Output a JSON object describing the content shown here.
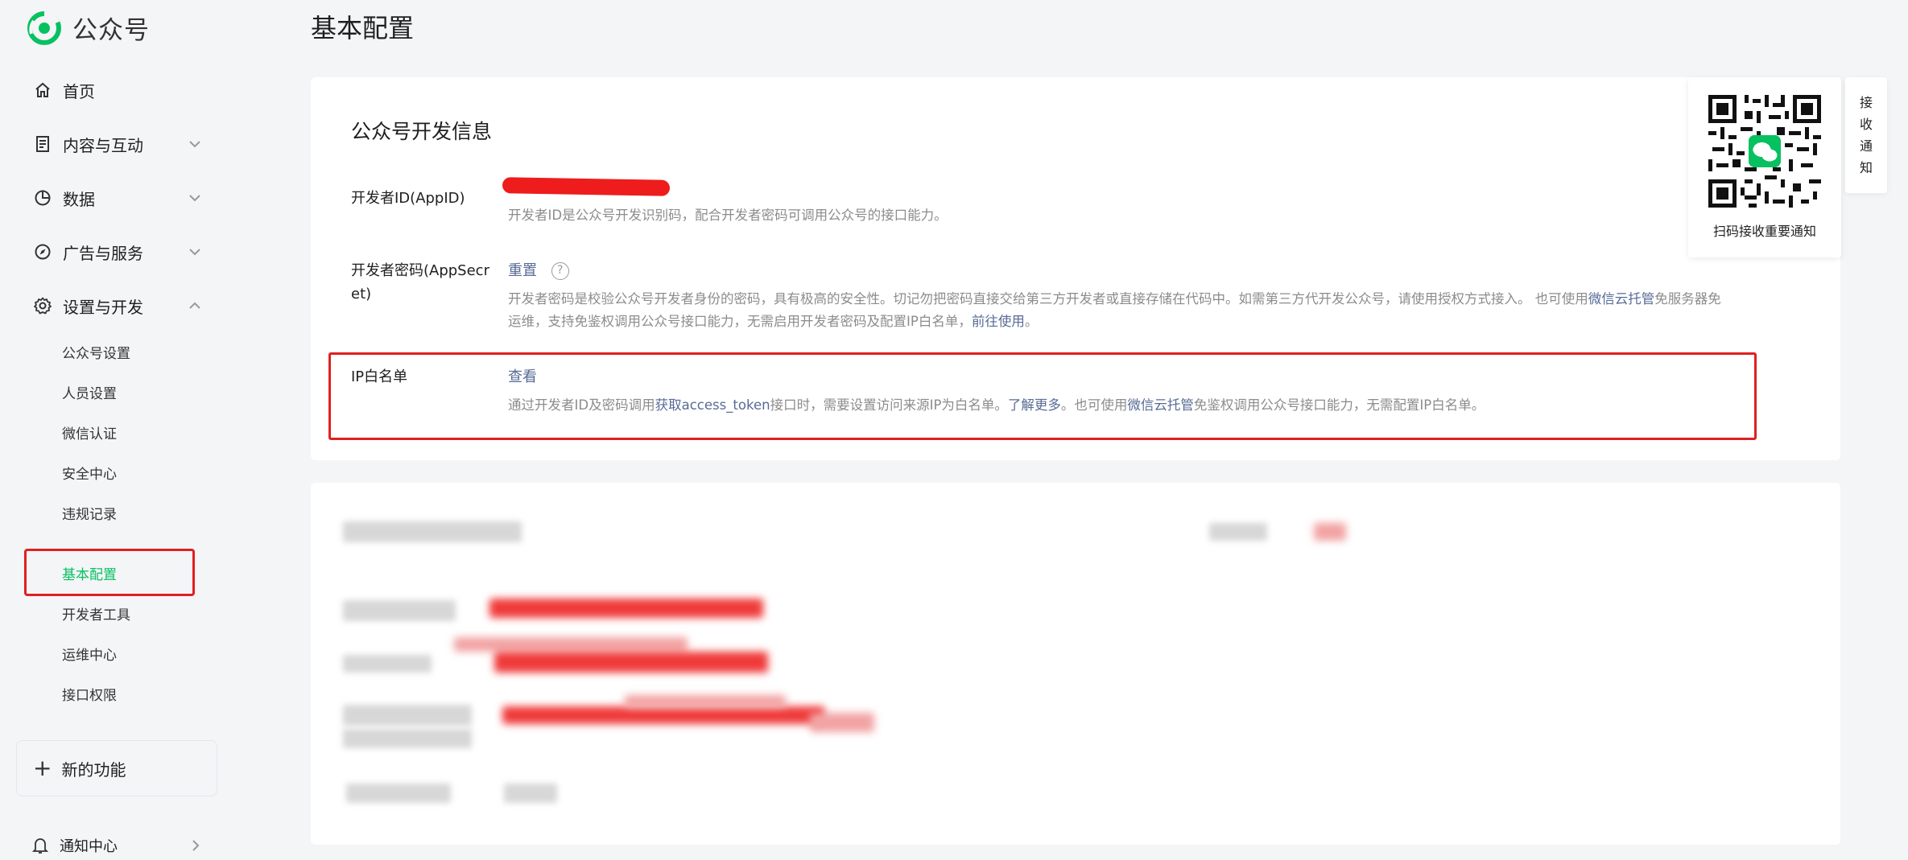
{
  "brand": {
    "name": "公众号"
  },
  "sidebar": {
    "items": [
      {
        "label": "首页",
        "icon": "home-icon"
      },
      {
        "label": "内容与互动",
        "icon": "document-icon",
        "chevron": "chevron-down-icon"
      },
      {
        "label": "数据",
        "icon": "pie-chart-icon",
        "chevron": "chevron-down-icon"
      },
      {
        "label": "广告与服务",
        "icon": "compass-icon",
        "chevron": "chevron-down-icon"
      },
      {
        "label": "设置与开发",
        "icon": "gear-icon",
        "chevron": "chevron-up-icon"
      }
    ],
    "sub_items": [
      {
        "label": "公众号设置",
        "active": false
      },
      {
        "label": "人员设置",
        "active": false
      },
      {
        "label": "微信认证",
        "active": false
      },
      {
        "label": "安全中心",
        "active": false
      },
      {
        "label": "违规记录",
        "active": false
      },
      {
        "label": "基本配置",
        "active": true
      },
      {
        "label": "开发者工具",
        "active": false
      },
      {
        "label": "运维中心",
        "active": false
      },
      {
        "label": "接口权限",
        "active": false
      }
    ],
    "new_function": "新的功能",
    "notice_center": "通知中心"
  },
  "page": {
    "title": "基本配置"
  },
  "dev_info": {
    "title": "公众号开发信息",
    "appid": {
      "label": "开发者ID(AppID)",
      "desc": "开发者ID是公众号开发识别码，配合开发者密码可调用公众号的接口能力。"
    },
    "appsecret": {
      "label": "开发者密码(AppSecret)",
      "action": "重置",
      "help": "?",
      "desc_part1": "开发者密码是校验公众号开发者身份的密码，具有极高的安全性。切记勿把密码直接交给第三方开发者或直接存储在代码中。如需第三方代开发公众号，请使用授权方式接入。 也可使用",
      "desc_link1": "微信云托管",
      "desc_part2": "免服务器免",
      "desc_line2": "运维，支持免鉴权调用公众号接口能力，无需启用开发者密码及配置IP白名单，",
      "desc_link2": "前往使用",
      "desc_end": "。"
    },
    "ip_whitelist": {
      "label": "IP白名单",
      "action": "查看",
      "desc_part1": "通过开发者ID及密码调用",
      "desc_link1": "获取access_token",
      "desc_part2": "接口时，需要设置访问来源IP为白名单。",
      "desc_link2": "了解更多",
      "desc_part3": "。也可使用",
      "desc_link3": "微信云托管",
      "desc_part4": "免鉴权调用公众号接口能力，无需配置IP白名单。"
    }
  },
  "qr_panel": {
    "caption": "扫码接收重要通知"
  },
  "side_tab": {
    "label": "接收通知"
  },
  "colors": {
    "accent": "#07c160",
    "link": "#576b95",
    "highlight": "#e02020",
    "redaction": "#ee1c1c"
  }
}
